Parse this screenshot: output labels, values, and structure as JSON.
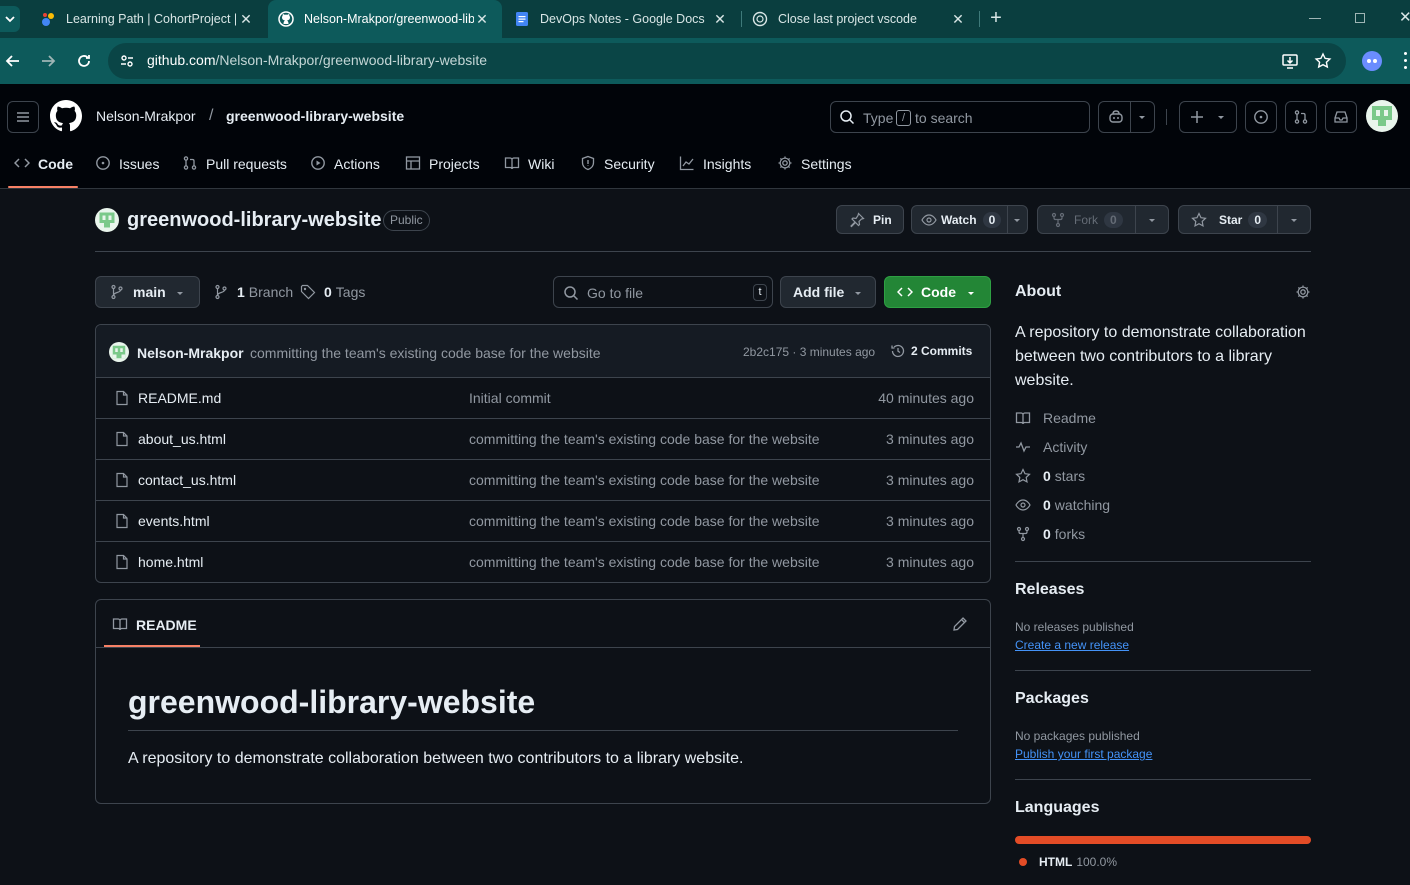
{
  "browser": {
    "tabs": [
      {
        "title": "Learning Path | CohortProject | ",
        "active": false
      },
      {
        "title": "Nelson-Mrakpor/greenwood-lib",
        "active": true
      },
      {
        "title": "DevOps Notes - Google Docs",
        "active": false
      },
      {
        "title": "Close last project vscode",
        "active": false
      }
    ],
    "url_host": "github.com",
    "url_path": "/Nelson-Mrakpor/greenwood-library-website"
  },
  "header": {
    "owner": "Nelson-Mrakpor",
    "separator": "/",
    "repo": "greenwood-library-website",
    "search_prefix": "Type",
    "search_key": "/",
    "search_suffix": "to search"
  },
  "nav": {
    "tabs": [
      {
        "label": "Code",
        "icon": "code-icon",
        "selected": true
      },
      {
        "label": "Issues",
        "icon": "issue-icon"
      },
      {
        "label": "Pull requests",
        "icon": "pull-request-icon"
      },
      {
        "label": "Actions",
        "icon": "play-icon"
      },
      {
        "label": "Projects",
        "icon": "table-icon"
      },
      {
        "label": "Wiki",
        "icon": "book-icon"
      },
      {
        "label": "Security",
        "icon": "shield-icon"
      },
      {
        "label": "Insights",
        "icon": "graph-icon"
      },
      {
        "label": "Settings",
        "icon": "gear-icon"
      }
    ]
  },
  "repo": {
    "name": "greenwood-library-website",
    "visibility": "Public",
    "pin_label": "Pin",
    "watch_label": "Watch",
    "watch_count": "0",
    "fork_label": "Fork",
    "fork_count": "0",
    "star_label": "Star",
    "star_count": "0"
  },
  "filebar": {
    "branch": "main",
    "branch_count": "1",
    "branch_label": "Branch",
    "tag_count": "0",
    "tag_label": "Tags",
    "goto_placeholder": "Go to file",
    "goto_key": "t",
    "add_file_label": "Add file",
    "code_label": "Code"
  },
  "commit": {
    "author": "Nelson-Mrakpor",
    "message": "committing the team's existing code base for the website",
    "sha_time": "2b2c175 · 3 minutes ago",
    "commits_label": "2 Commits"
  },
  "files": [
    {
      "name": "README.md",
      "message": "Initial commit",
      "time": "40 minutes ago"
    },
    {
      "name": "about_us.html",
      "message": "committing the team's existing code base for the website",
      "time": "3 minutes ago"
    },
    {
      "name": "contact_us.html",
      "message": "committing the team's existing code base for the website",
      "time": "3 minutes ago"
    },
    {
      "name": "events.html",
      "message": "committing the team's existing code base for the website",
      "time": "3 minutes ago"
    },
    {
      "name": "home.html",
      "message": "committing the team's existing code base for the website",
      "time": "3 minutes ago"
    }
  ],
  "readme": {
    "tab_label": "README",
    "heading": "greenwood-library-website",
    "body": "A repository to demonstrate collaboration between two contributors to a library website."
  },
  "about": {
    "heading": "About",
    "description": "A repository to demonstrate collaboration between two contributors to a library website.",
    "items": [
      {
        "icon": "book-icon",
        "count": "",
        "label": "Readme"
      },
      {
        "icon": "pulse-icon",
        "count": "",
        "label": "Activity"
      },
      {
        "icon": "star-icon",
        "count": "0",
        "label": "stars"
      },
      {
        "icon": "eye-icon",
        "count": "0",
        "label": "watching"
      },
      {
        "icon": "fork-icon",
        "count": "0",
        "label": "forks"
      }
    ]
  },
  "releases": {
    "heading": "Releases",
    "note": "No releases published",
    "link": "Create a new release"
  },
  "packages": {
    "heading": "Packages",
    "note": "No packages published",
    "link": "Publish your first package"
  },
  "languages": {
    "heading": "Languages",
    "items": [
      {
        "name": "HTML",
        "percent": "100.0%",
        "fraction": 1.0,
        "color": "#e34c26"
      }
    ]
  },
  "colors": {
    "accent_green": "#238636",
    "link_blue": "#4493f8",
    "tab_underline": "#f78166",
    "browser_teal": "#0d5a5b"
  }
}
